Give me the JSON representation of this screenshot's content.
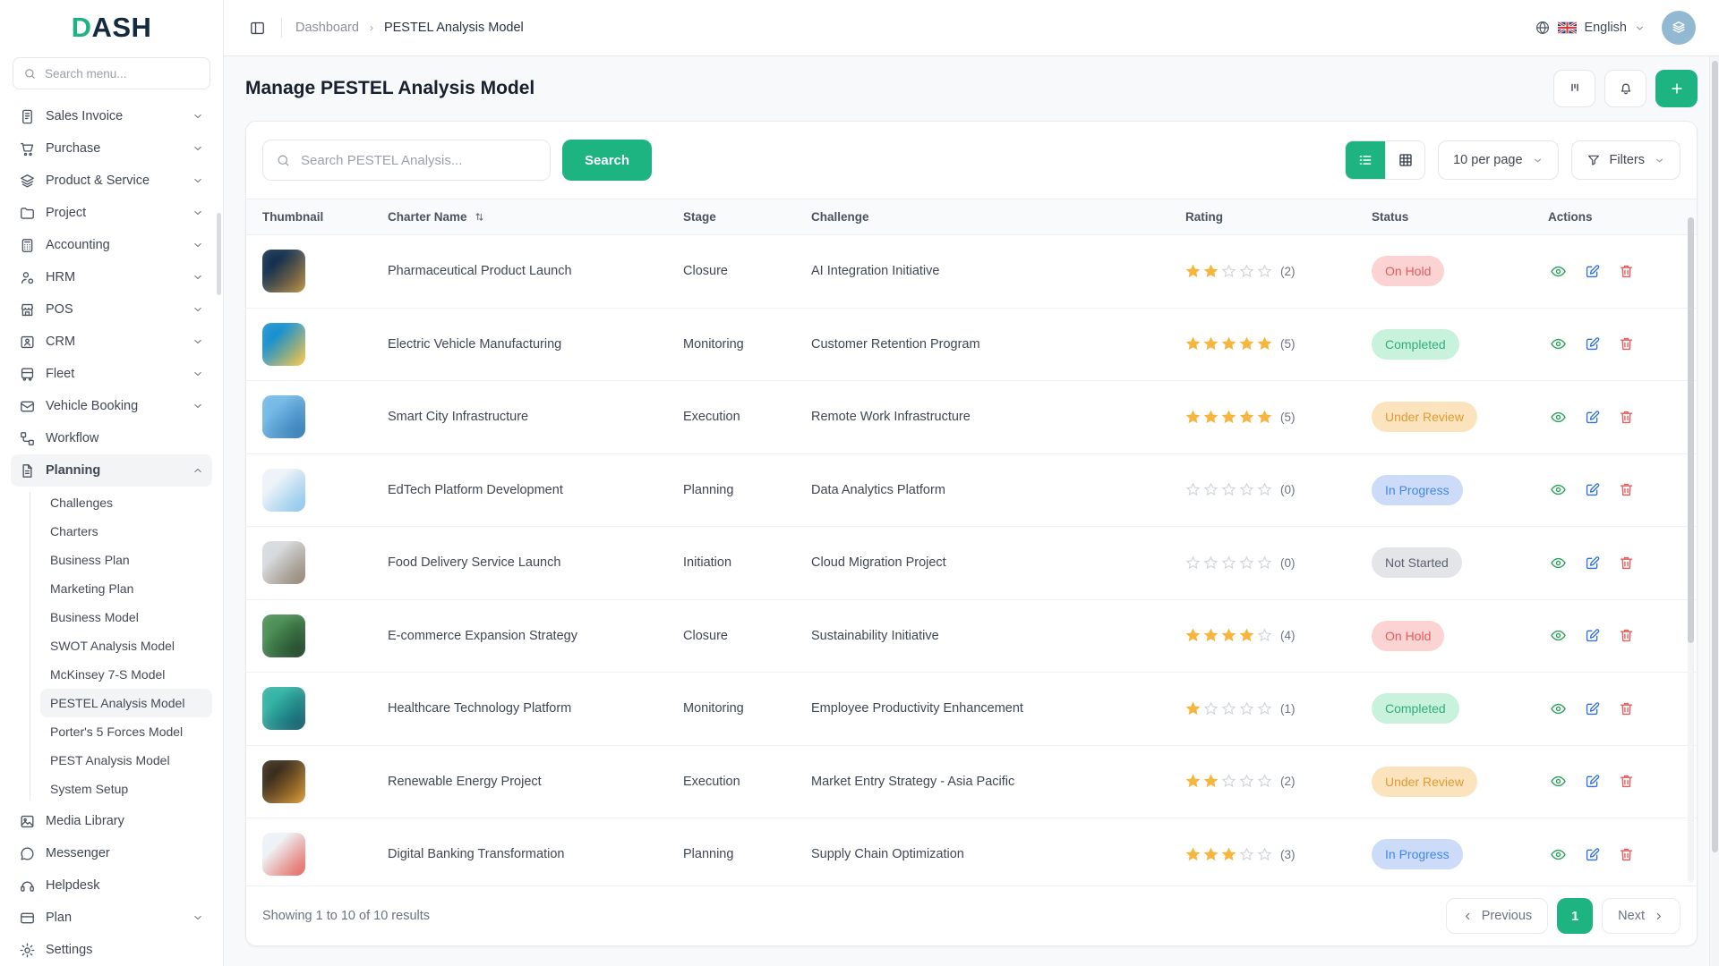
{
  "theme": {
    "accent": "#1eb482",
    "star": "#f4b63f",
    "view_icon": "#27a05c",
    "edit_icon": "#2f6fe0",
    "delete_icon": "#e25c5c"
  },
  "brand": {
    "logo_d": "D",
    "logo_rest": "ASH"
  },
  "sidebar": {
    "search_placeholder": "Search menu...",
    "items": [
      {
        "label": "Sales Invoice",
        "icon": "invoice",
        "expandable": true
      },
      {
        "label": "Purchase",
        "icon": "cart",
        "expandable": true
      },
      {
        "label": "Product & Service",
        "icon": "layers",
        "expandable": true
      },
      {
        "label": "Project",
        "icon": "folder",
        "expandable": true
      },
      {
        "label": "Accounting",
        "icon": "calculator",
        "expandable": true
      },
      {
        "label": "HRM",
        "icon": "user-gear",
        "expandable": true
      },
      {
        "label": "POS",
        "icon": "store",
        "expandable": true
      },
      {
        "label": "CRM",
        "icon": "id-card",
        "expandable": true
      },
      {
        "label": "Fleet",
        "icon": "bus",
        "expandable": true
      },
      {
        "label": "Vehicle Booking",
        "icon": "mail-check",
        "expandable": true
      },
      {
        "label": "Workflow",
        "icon": "workflow",
        "expandable": false
      },
      {
        "label": "Planning",
        "icon": "file-text",
        "expandable": true,
        "expanded": true,
        "active": true,
        "children": [
          "Challenges",
          "Charters",
          "Business Plan",
          "Marketing Plan",
          "Business Model",
          "SWOT Analysis Model",
          "McKinsey 7-S Model",
          "PESTEL Analysis Model",
          "Porter's 5 Forces Model",
          "PEST Analysis Model",
          "System Setup"
        ],
        "active_child": "PESTEL Analysis Model"
      },
      {
        "label": "Media Library",
        "icon": "image",
        "expandable": false
      },
      {
        "label": "Messenger",
        "icon": "chat",
        "expandable": false
      },
      {
        "label": "Helpdesk",
        "icon": "headset",
        "expandable": false
      },
      {
        "label": "Plan",
        "icon": "credit-card",
        "expandable": true
      },
      {
        "label": "Settings",
        "icon": "gear",
        "expandable": false
      }
    ]
  },
  "topbar": {
    "breadcrumb": [
      "Dashboard",
      "PESTEL Analysis Model"
    ],
    "language": "English"
  },
  "page": {
    "title": "Manage PESTEL Analysis Model"
  },
  "controls": {
    "search_placeholder": "Search PESTEL Analysis...",
    "search_button": "Search",
    "per_page": "10 per page",
    "filters_label": "Filters"
  },
  "table": {
    "columns": [
      "Thumbnail",
      "Charter Name",
      "Stage",
      "Challenge",
      "Rating",
      "Status",
      "Actions"
    ],
    "rows": [
      {
        "name": "Pharmaceutical Product Launch",
        "stage": "Closure",
        "challenge": "AI Integration Initiative",
        "rating": 2,
        "rating_max": 5,
        "status": "On Hold",
        "thumb": [
          "#13304f",
          "#b98a3a"
        ]
      },
      {
        "name": "Electric Vehicle Manufacturing",
        "stage": "Monitoring",
        "challenge": "Customer Retention Program",
        "rating": 5,
        "rating_max": 5,
        "status": "Completed",
        "thumb": [
          "#1791d0",
          "#ffc53d"
        ]
      },
      {
        "name": "Smart City Infrastructure",
        "stage": "Execution",
        "challenge": "Remote Work Infrastructure",
        "rating": 5,
        "rating_max": 5,
        "status": "Under Review",
        "thumb": [
          "#74b9e6",
          "#2a72ad"
        ]
      },
      {
        "name": "EdTech Platform Development",
        "stage": "Planning",
        "challenge": "Data Analytics Platform",
        "rating": 0,
        "rating_max": 5,
        "status": "In Progress",
        "thumb": [
          "#eef3f9",
          "#7fc0e8"
        ]
      },
      {
        "name": "Food Delivery Service Launch",
        "stage": "Initiation",
        "challenge": "Cloud Migration Project",
        "rating": 0,
        "rating_max": 5,
        "status": "Not Started",
        "thumb": [
          "#d7dade",
          "#8a7a66"
        ]
      },
      {
        "name": "E-commerce Expansion Strategy",
        "stage": "Closure",
        "challenge": "Sustainability Initiative",
        "rating": 4,
        "rating_max": 5,
        "status": "On Hold",
        "thumb": [
          "#4c8f55",
          "#16371f"
        ]
      },
      {
        "name": "Healthcare Technology Platform",
        "stage": "Monitoring",
        "challenge": "Employee Productivity Enhancement",
        "rating": 1,
        "rating_max": 5,
        "status": "Completed",
        "thumb": [
          "#33b3a5",
          "#0c4f63"
        ]
      },
      {
        "name": "Renewable Energy Project",
        "stage": "Execution",
        "challenge": "Market Entry Strategy - Asia Pacific",
        "rating": 2,
        "rating_max": 5,
        "status": "Under Review",
        "thumb": [
          "#3a2d1c",
          "#d9952f"
        ]
      },
      {
        "name": "Digital Banking Transformation",
        "stage": "Planning",
        "challenge": "Supply Chain Optimization",
        "rating": 3,
        "rating_max": 5,
        "status": "In Progress",
        "thumb": [
          "#eef2f6",
          "#e2574f"
        ]
      }
    ]
  },
  "status_styles": {
    "On Hold": {
      "bg": "#fbd3d3",
      "text": "#e25c5c"
    },
    "Completed": {
      "bg": "#c9f2dd",
      "text": "#2fae76"
    },
    "Under Review": {
      "bg": "#fbe4bd",
      "text": "#e09b33"
    },
    "In Progress": {
      "bg": "#ccdbf8",
      "text": "#4387ea"
    },
    "Not Started": {
      "bg": "#e3e5e9",
      "text": "#5a6270"
    }
  },
  "footer": {
    "summary": "Showing 1 to 10 of 10 results",
    "previous": "Previous",
    "page": "1",
    "next": "Next"
  }
}
